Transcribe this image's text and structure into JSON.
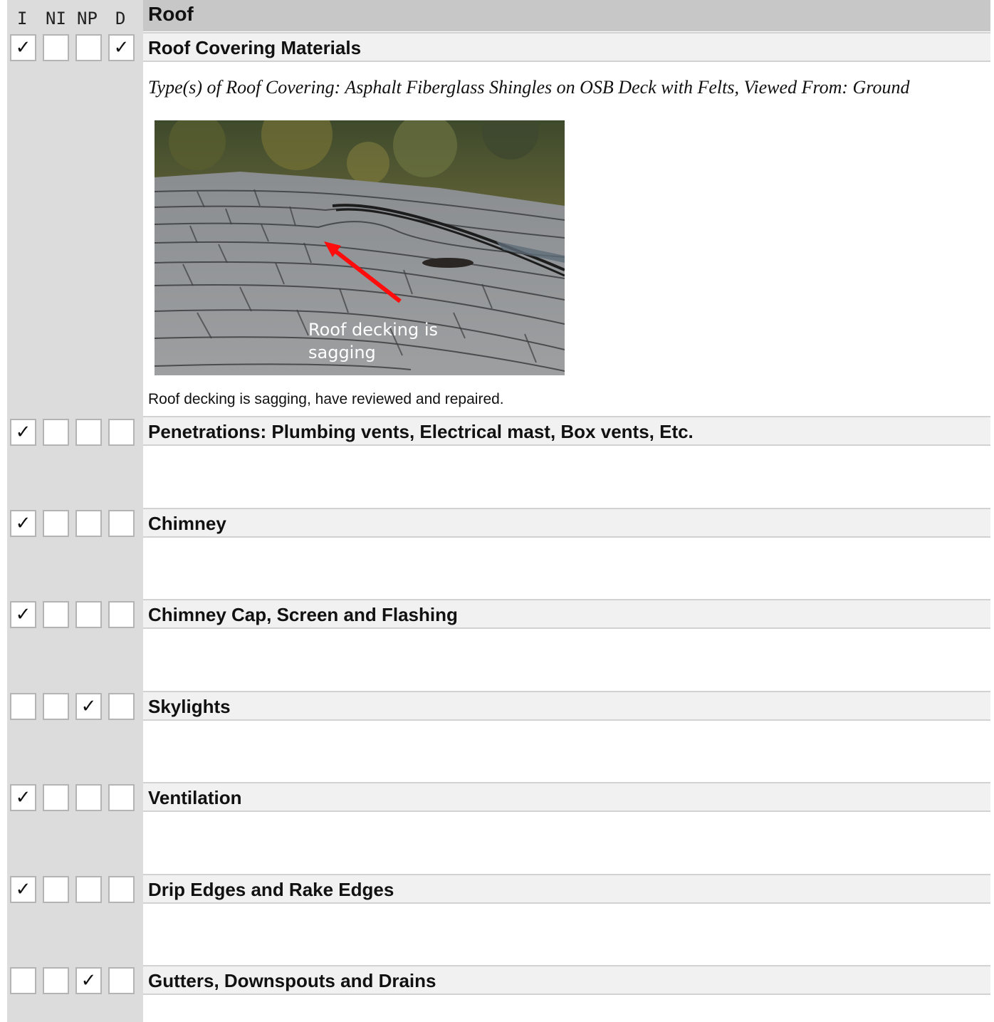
{
  "header": {
    "col_labels": [
      "I",
      "NI",
      "NP",
      "D"
    ],
    "title": "Roof"
  },
  "sections": [
    {
      "title": "Roof Covering Materials",
      "checks": [
        true,
        false,
        false,
        true
      ]
    },
    {
      "title": "Penetrations: Plumbing vents, Electrical mast, Box vents, Etc.",
      "checks": [
        true,
        false,
        false,
        false
      ]
    },
    {
      "title": "Chimney",
      "checks": [
        true,
        false,
        false,
        false
      ]
    },
    {
      "title": "Chimney Cap, Screen and Flashing",
      "checks": [
        true,
        false,
        false,
        false
      ]
    },
    {
      "title": "Skylights",
      "checks": [
        false,
        false,
        true,
        false
      ]
    },
    {
      "title": "Ventilation",
      "checks": [
        true,
        false,
        false,
        false
      ]
    },
    {
      "title": "Drip Edges and Rake Edges",
      "checks": [
        true,
        false,
        false,
        false
      ]
    },
    {
      "title": "Gutters, Downspouts and Drains",
      "checks": [
        false,
        false,
        true,
        false
      ]
    }
  ],
  "roof_covering": {
    "type_line": "Type(s) of Roof Covering: Asphalt Fiberglass Shingles on OSB Deck with Felts, Viewed From: Ground",
    "photo_caption_line1": "Roof decking is",
    "photo_caption_line2": "sagging",
    "comment": "Roof decking is sagging, have reviewed and repaired."
  },
  "check_glyph": "✓"
}
